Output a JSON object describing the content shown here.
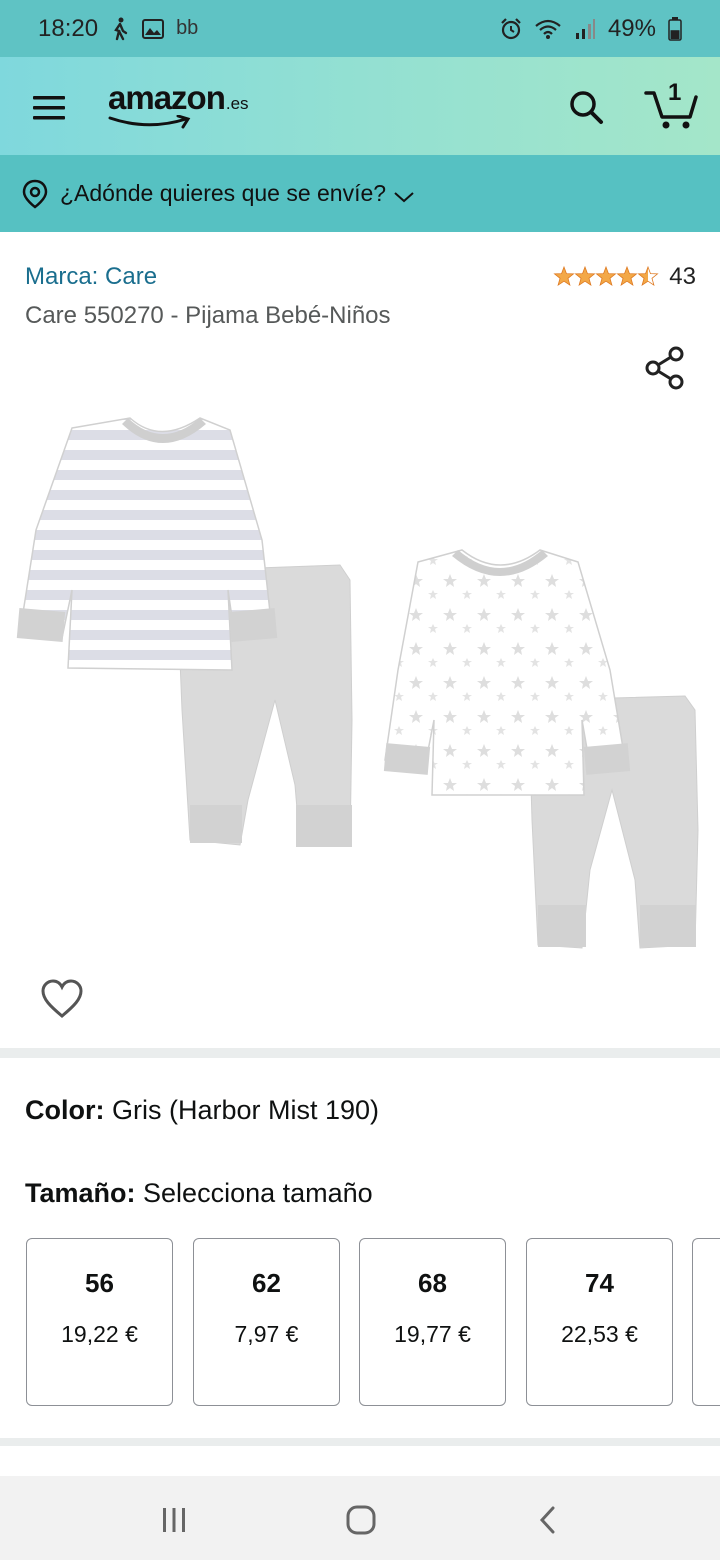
{
  "status_bar": {
    "time": "18:20",
    "carrier_text": "bb",
    "battery_percent": "49%",
    "battery_level": 0.49
  },
  "header": {
    "logo_text": "amazon",
    "logo_tld": ".es",
    "cart_count": "1"
  },
  "delivery": {
    "label": "¿Adónde quieres que se envíe?"
  },
  "product": {
    "brand_link": "Marca: Care",
    "rating_value": 4.5,
    "rating_count": "43",
    "title": "Care 550270 - Pijama Bebé-Niños"
  },
  "variations": {
    "color_label": "Color:",
    "color_value": "Gris (Harbor Mist 190)",
    "size_label": "Tamaño:",
    "size_value": "Selecciona tamaño",
    "sizes": [
      {
        "size": "56",
        "price": "19,22 €"
      },
      {
        "size": "62",
        "price": "7,97 €"
      },
      {
        "size": "68",
        "price": "19,77 €"
      },
      {
        "size": "74",
        "price": "22,53 €"
      }
    ]
  },
  "colors": {
    "status_bar": "#5fc3c4",
    "delivery_bar": "#56c1c2",
    "link": "#1a6e8e",
    "star": "#f3a847"
  },
  "icons": [
    "walking-icon",
    "image-icon",
    "alarm-icon",
    "wifi-icon",
    "signal-icon",
    "battery-icon",
    "menu-icon",
    "search-icon",
    "cart-icon",
    "location-pin-icon",
    "chevron-down-icon",
    "share-icon",
    "heart-icon",
    "recents-icon",
    "home-icon",
    "back-icon"
  ]
}
